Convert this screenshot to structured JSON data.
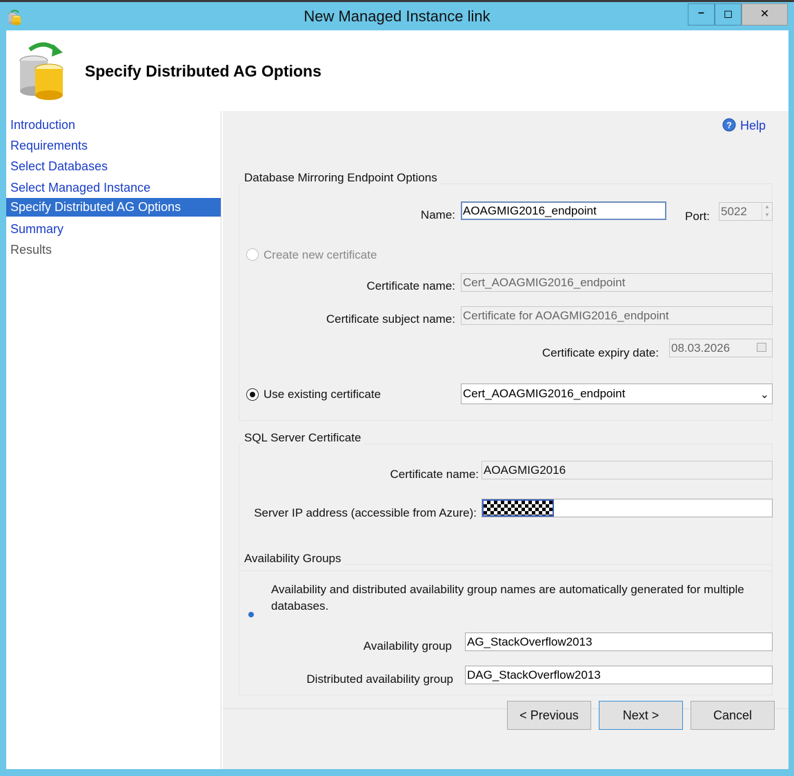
{
  "window": {
    "title": "New Managed Instance link",
    "min_glyph": "–",
    "max_glyph": "◻",
    "close_glyph": "✕"
  },
  "header": {
    "title": "Specify Distributed AG Options"
  },
  "nav": {
    "items": [
      {
        "label": "Introduction",
        "state": "link"
      },
      {
        "label": "Requirements",
        "state": "link"
      },
      {
        "label": "Select Databases",
        "state": "link"
      },
      {
        "label": "Select Managed Instance",
        "state": "link"
      },
      {
        "label": "Specify Distributed AG Options",
        "state": "selected"
      },
      {
        "label": "Summary",
        "state": "link"
      },
      {
        "label": "Results",
        "state": "disabled"
      }
    ]
  },
  "help": {
    "label": "Help"
  },
  "endpoint": {
    "group_title": "Database Mirroring Endpoint Options",
    "name_label": "Name:",
    "name_value": "AOAGMIG2016_endpoint",
    "port_label": "Port:",
    "port_value": "5022",
    "create_cert_label": "Create new certificate",
    "cert_name_label": "Certificate name:",
    "cert_name_value": "Cert_AOAGMIG2016_endpoint",
    "cert_subject_label": "Certificate subject name:",
    "cert_subject_value": "Certificate for AOAGMIG2016_endpoint",
    "expiry_label": "Certificate expiry date:",
    "expiry_value": "08.03.2026",
    "use_existing_label": "Use existing certificate",
    "existing_cert_value": "Cert_AOAGMIG2016_endpoint"
  },
  "sql_cert": {
    "group_title": "SQL Server Certificate",
    "cert_name_label": "Certificate name:",
    "cert_name_value": "AOAGMIG2016",
    "ip_label": "Server IP address (accessible from Azure):"
  },
  "ag": {
    "group_title": "Availability Groups",
    "info_line1": "Availability and distributed availability group names are automatically generated for multiple",
    "info_line2": "databases.",
    "ag_label": "Availability group",
    "ag_value": "AG_StackOverflow2013",
    "dag_label": "Distributed availability group",
    "dag_value": "DAG_StackOverflow2013"
  },
  "footer": {
    "previous_label": "< Previous",
    "next_label": "Next >",
    "cancel_label": "Cancel"
  }
}
